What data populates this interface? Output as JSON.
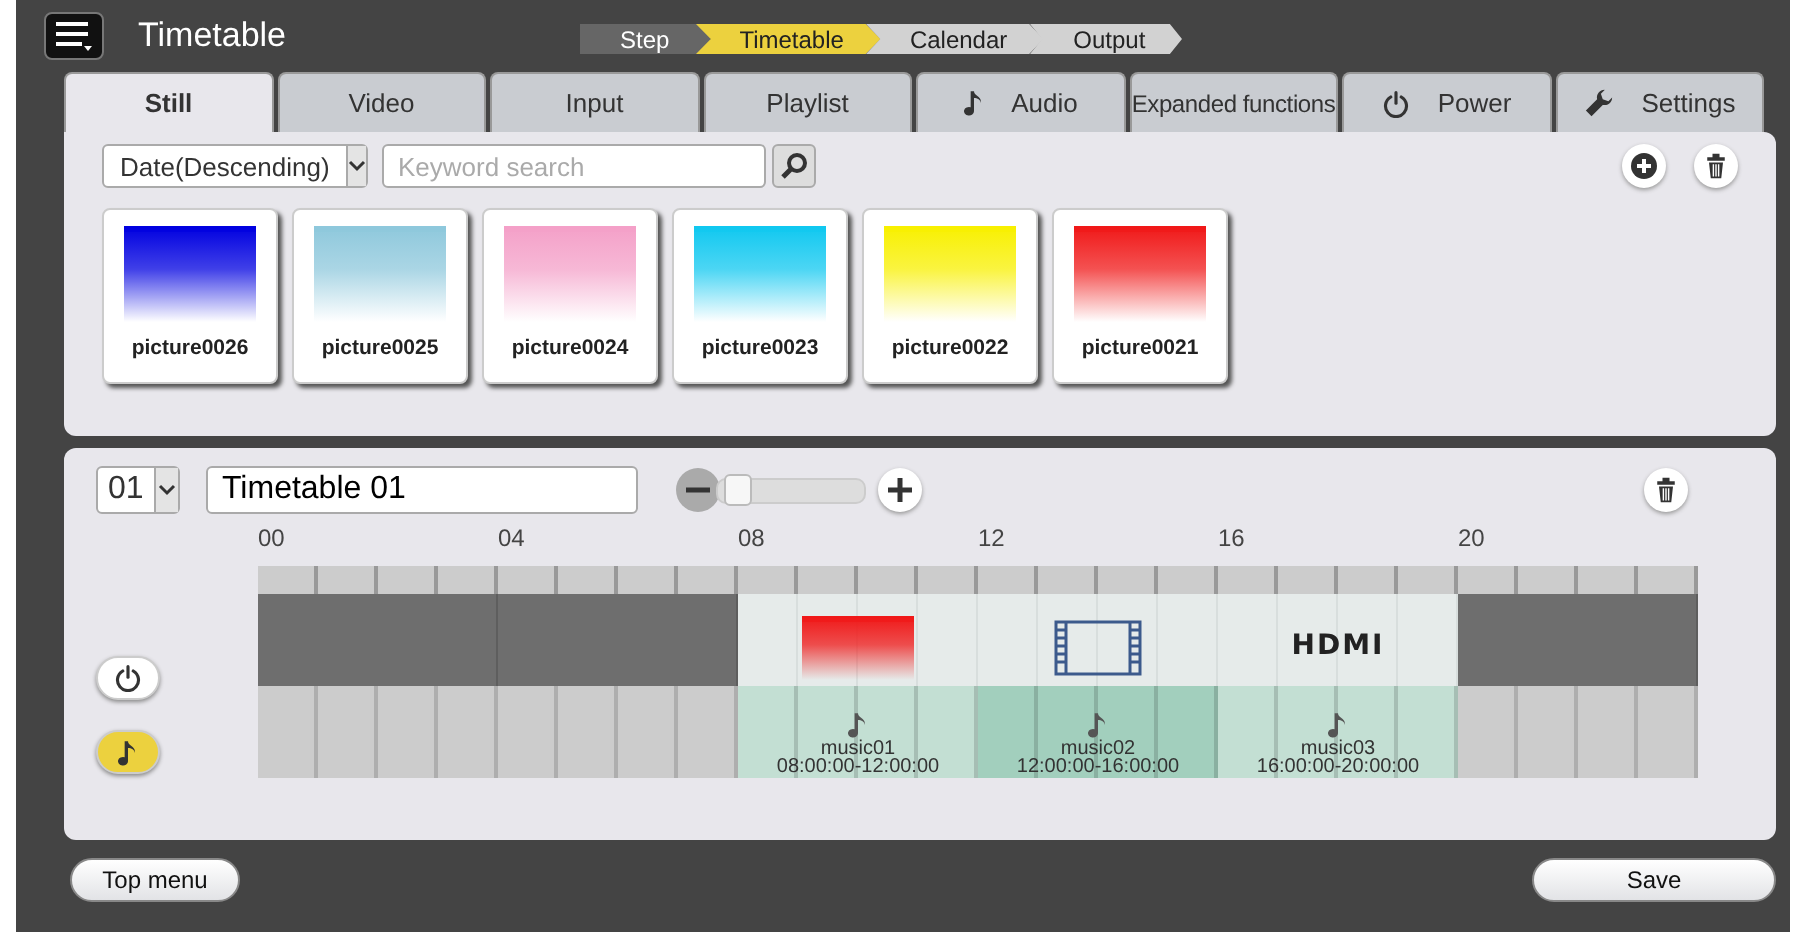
{
  "header": {
    "title": "Timetable"
  },
  "steps": [
    {
      "label": "Step",
      "kind": "caption"
    },
    {
      "label": "Timetable",
      "kind": "step",
      "selected": true
    },
    {
      "label": "Calendar",
      "kind": "step",
      "selected": false
    },
    {
      "label": "Output",
      "kind": "step",
      "selected": false
    }
  ],
  "tabs": [
    {
      "label": "Still",
      "kind": "plain",
      "selected": true
    },
    {
      "label": "Video",
      "kind": "plain",
      "selected": false
    },
    {
      "label": "Input",
      "kind": "plain",
      "selected": false
    },
    {
      "label": "Playlist",
      "kind": "plain",
      "selected": false
    },
    {
      "label": "Audio",
      "kind": "note",
      "selected": false
    },
    {
      "label": "Expanded functions",
      "kind": "plain",
      "selected": false
    },
    {
      "label": "Power",
      "kind": "power",
      "selected": false
    },
    {
      "label": "Settings",
      "kind": "wrench",
      "selected": false
    }
  ],
  "library": {
    "sort": "Date(Descending)",
    "search_placeholder": "Keyword search",
    "items": [
      {
        "name": "picture0026",
        "color": "#0000e0"
      },
      {
        "name": "picture0025",
        "color": "#8ec8dc"
      },
      {
        "name": "picture0024",
        "color": "#f4a0c8"
      },
      {
        "name": "picture0023",
        "color": "#10c8f0"
      },
      {
        "name": "picture0022",
        "color": "#f8f000"
      },
      {
        "name": "picture0021",
        "color": "#f01818"
      }
    ]
  },
  "timetable": {
    "number": "01",
    "name": "Timetable 01",
    "zoom": {
      "level": 0.05
    },
    "hours": [
      "00",
      "04",
      "08",
      "12",
      "16",
      "20"
    ],
    "rows": [
      {
        "kind": "power",
        "selected": false,
        "blocks": [
          {
            "kind": "off"
          },
          {
            "kind": "off"
          },
          {
            "kind": "picture",
            "color": "#f01818"
          },
          {
            "kind": "video"
          },
          {
            "kind": "hdmi",
            "label": "HDMI"
          },
          {
            "kind": "off"
          }
        ]
      },
      {
        "kind": "audio",
        "selected": true,
        "blocks": [
          {
            "kind": "empty"
          },
          {
            "kind": "empty"
          },
          {
            "kind": "music",
            "name": "music01",
            "time": "08:00:00-12:00:00",
            "selected": false
          },
          {
            "kind": "music",
            "name": "music02",
            "time": "12:00:00-16:00:00",
            "selected": true
          },
          {
            "kind": "music",
            "name": "music03",
            "time": "16:00:00-20:00:00",
            "selected": false
          },
          {
            "kind": "empty"
          }
        ]
      }
    ]
  },
  "footer": {
    "buttons": [
      "Top menu",
      "Save"
    ]
  }
}
